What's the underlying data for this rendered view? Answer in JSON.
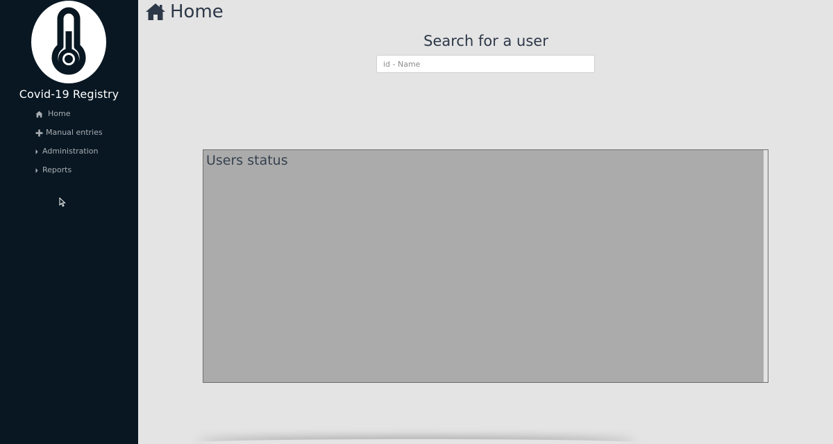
{
  "app": {
    "brand": "Covid-19 Registry",
    "logo_icon": "thermometer-icon"
  },
  "sidebar": {
    "items": [
      {
        "label": "Home",
        "icon": "home-icon"
      },
      {
        "label": "Manual entries",
        "icon": "plus-icon"
      },
      {
        "label": "Administration",
        "icon": "caret-right-icon"
      },
      {
        "label": "Reports",
        "icon": "caret-right-icon"
      }
    ]
  },
  "header": {
    "title": "Home",
    "icon": "home-icon"
  },
  "search": {
    "heading": "Search for a user",
    "placeholder": "id - Name",
    "value": ""
  },
  "users_status": {
    "title": "Users status"
  },
  "colors": {
    "sidebar_bg": "#081722",
    "main_bg": "#e4e4e4",
    "panel_bg": "#ababab",
    "heading_text": "#2d3848",
    "nav_text": "#a8aeb3"
  }
}
